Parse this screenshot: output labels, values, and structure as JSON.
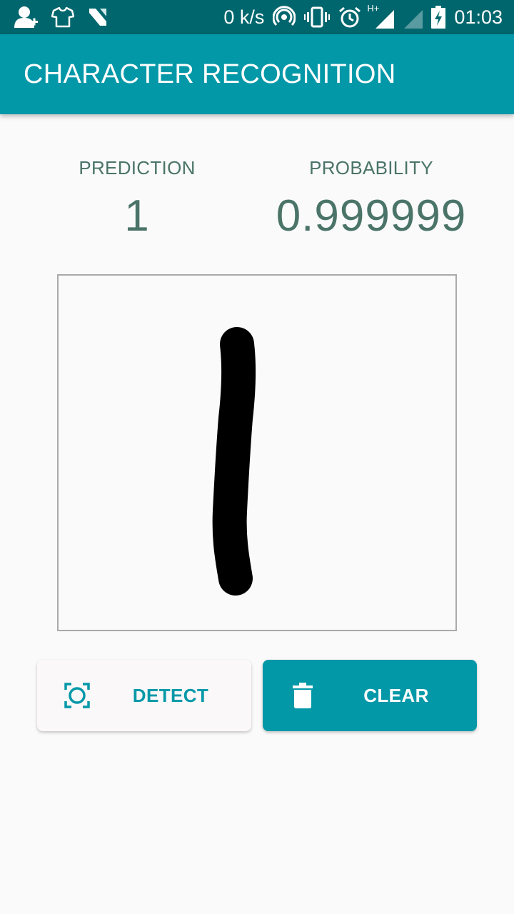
{
  "status_bar": {
    "left_icons": [
      "person-add-icon",
      "tshirt-icon",
      "n-logo-icon"
    ],
    "speed": "0 k/s",
    "right_icons": [
      "hotspot-icon",
      "vibrate-icon",
      "alarm-icon",
      "signal-hplus-icon",
      "signal-weak-icon",
      "battery-charging-icon"
    ],
    "network_label": "H+",
    "time": "01:03"
  },
  "app_bar": {
    "title": "CHARACTER RECOGNITION"
  },
  "stats": {
    "prediction": {
      "label": "PREDICTION",
      "value": "1"
    },
    "probability": {
      "label": "PROBABILITY",
      "value": "0.999999"
    }
  },
  "canvas": {
    "name": "drawing-canvas"
  },
  "buttons": {
    "detect": {
      "label": "DETECT",
      "icon": "detect-scan-icon"
    },
    "clear": {
      "label": "CLEAR",
      "icon": "trash-icon"
    }
  },
  "colors": {
    "status_bar": "#00666d",
    "primary": "#0398a8",
    "text_secondary": "#4b7468",
    "background": "#fafafa",
    "stroke": "#000000"
  }
}
